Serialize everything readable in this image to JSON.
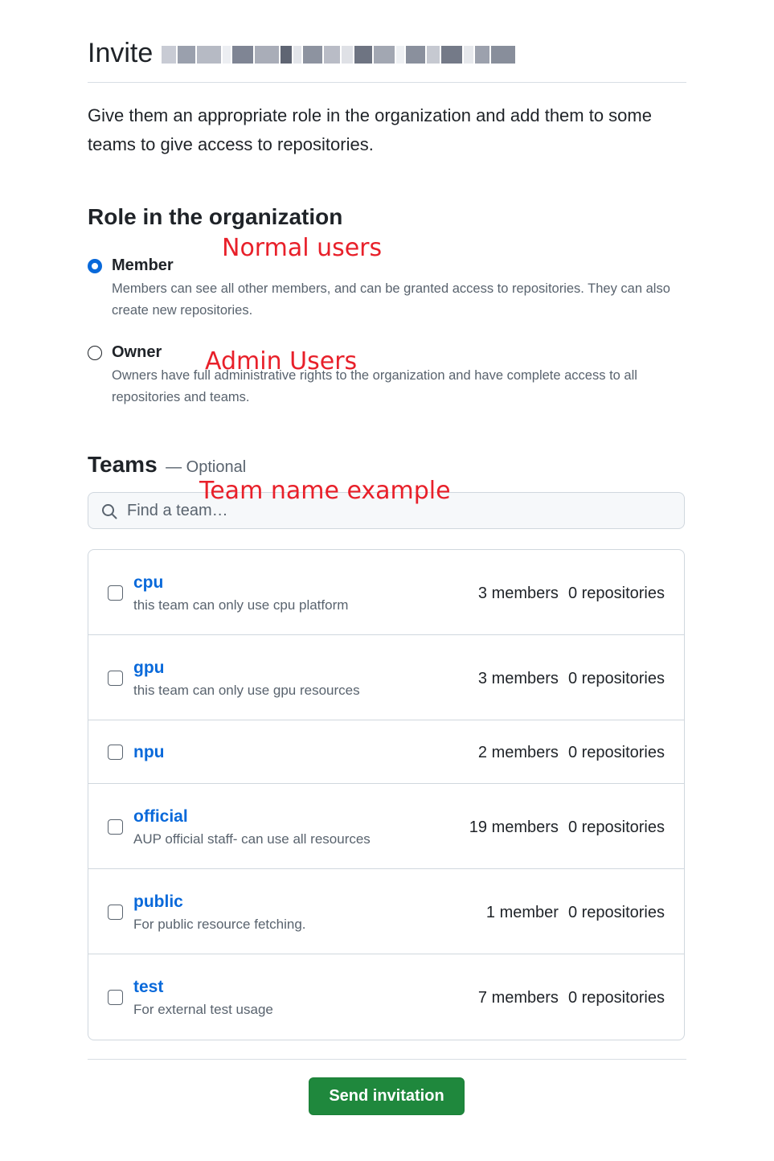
{
  "header": {
    "title": "Invite"
  },
  "intro": "Give them an appropriate role in the organization and add them to some teams to give access to repositories.",
  "role_section": {
    "title": "Role in the organization",
    "roles": [
      {
        "name": "Member",
        "checked": true,
        "description": "Members can see all other members, and can be granted access to repositories. They can also create new repositories."
      },
      {
        "name": "Owner",
        "checked": false,
        "description": "Owners have full administrative rights to the organization and have complete access to all repositories and teams."
      }
    ]
  },
  "annotations": {
    "member": "Normal users",
    "owner": "Admin Users",
    "teams": "Team name example",
    "color": "#e8202a"
  },
  "teams_section": {
    "title": "Teams",
    "optional": "— Optional",
    "search_placeholder": "Find a team…",
    "teams": [
      {
        "name": "cpu",
        "description": "this team can only use cpu platform",
        "members": "3 members",
        "repositories": "0 repositories"
      },
      {
        "name": "gpu",
        "description": "this team can only use gpu resources",
        "members": "3 members",
        "repositories": "0 repositories"
      },
      {
        "name": "npu",
        "description": "",
        "members": "2 members",
        "repositories": "0 repositories"
      },
      {
        "name": "official",
        "description": "AUP official staff- can use all resources",
        "members": "19 members",
        "repositories": "0 repositories"
      },
      {
        "name": "public",
        "description": "For public resource fetching.",
        "members": "1 member",
        "repositories": "0 repositories"
      },
      {
        "name": "test",
        "description": "For external test usage",
        "members": "7 members",
        "repositories": "0 repositories"
      }
    ]
  },
  "actions": {
    "send_label": "Send invitation",
    "send_color": "#1f883d"
  },
  "colors": {
    "link": "#0969da",
    "radio_checked": "#0969da",
    "muted_text": "#59636e"
  }
}
